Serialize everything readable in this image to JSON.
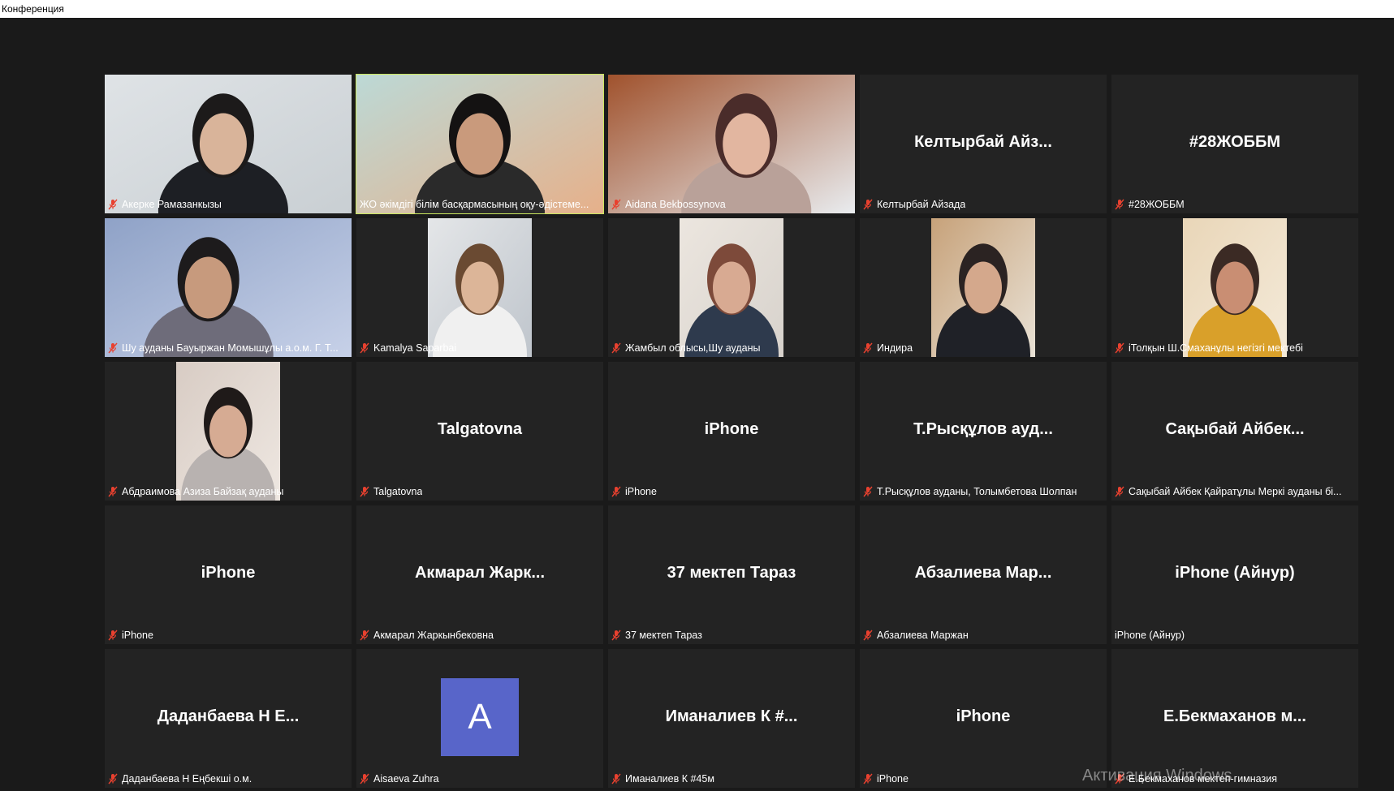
{
  "window": {
    "title": "Конференция"
  },
  "watermark": "Активация Windows",
  "colors": {
    "background": "#1a1a1a",
    "tile": "#232323",
    "active_border": "#c9e65d",
    "mic_muted": "#e8412f",
    "avatar": "#5865c9"
  },
  "tiles": [
    {
      "label": "Акерке Рамазанкызы",
      "muted": true,
      "video": "woman-dark-hair-office"
    },
    {
      "label": "ЖО әкімдігі білім басқармасының оқу-әдістеме...",
      "muted": false,
      "video": "older-woman-glasses",
      "active": true
    },
    {
      "label": "Aidana Bekbossynova",
      "muted": true,
      "video": "woman-room-shelves"
    },
    {
      "label": "Келтырбай Айзада",
      "muted": true,
      "name": "Келтырбай Айз..."
    },
    {
      "label": "#28ЖОББМ",
      "muted": true,
      "name": "#28ЖОББМ"
    },
    {
      "label": "Шу ауданы Бауыржан Момышұлы а.о.м. Г. Т...",
      "muted": true,
      "video": "woman-closeup"
    },
    {
      "label": "Kamalya Saparbai",
      "muted": true,
      "video": "woman-long-hair",
      "narrow": true
    },
    {
      "label": "Жамбыл облысы,Шу ауданы",
      "muted": true,
      "video": "woman-speaking",
      "narrow": true
    },
    {
      "label": "Индира",
      "muted": true,
      "video": "woman-vest",
      "narrow": true
    },
    {
      "label": "іТолқын Ш.Смаханұлы негізгі мектебі",
      "muted": true,
      "video": "woman-yellow",
      "narrow": true
    },
    {
      "label": "Абдраимова Азиза Байзақ ауданы",
      "muted": true,
      "video": "young-woman",
      "narrow": true
    },
    {
      "label": "Talgatovna",
      "muted": true,
      "name": "Talgatovna"
    },
    {
      "label": "iPhone",
      "muted": true,
      "name": "iPhone"
    },
    {
      "label": "Т.Рысқұлов ауданы, Толымбетова Шолпан",
      "muted": true,
      "name": "Т.Рысқұлов ауд..."
    },
    {
      "label": "Сақыбай Айбек Қайратұлы Меркі  ауданы бі...",
      "muted": true,
      "name": "Сақыбай Айбек..."
    },
    {
      "label": "iPhone",
      "muted": true,
      "name": "iPhone"
    },
    {
      "label": "Акмарал Жаркынбековна",
      "muted": true,
      "name": "Акмарал Жарк..."
    },
    {
      "label": "37 мектеп Тараз",
      "muted": true,
      "name": "37 мектеп Тараз"
    },
    {
      "label": "Абзалиева Маржан",
      "muted": true,
      "name": "Абзалиева Мар..."
    },
    {
      "label": "iPhone (Айнур)",
      "muted": false,
      "name": "iPhone (Айнур)"
    },
    {
      "label": "Даданбаева Н Еңбекші о.м.",
      "muted": true,
      "name": "Даданбаева Н Е..."
    },
    {
      "label": "Aisaeva Zuhra",
      "muted": true,
      "avatar": "A"
    },
    {
      "label": "Иманалиев К #45м",
      "muted": true,
      "name": "Иманалиев К #..."
    },
    {
      "label": "iPhone",
      "muted": true,
      "name": "iPhone"
    },
    {
      "label": "Е.Бекмаханов мектеп-гимназия",
      "muted": true,
      "name": "Е.Бекмаханов  м..."
    }
  ]
}
